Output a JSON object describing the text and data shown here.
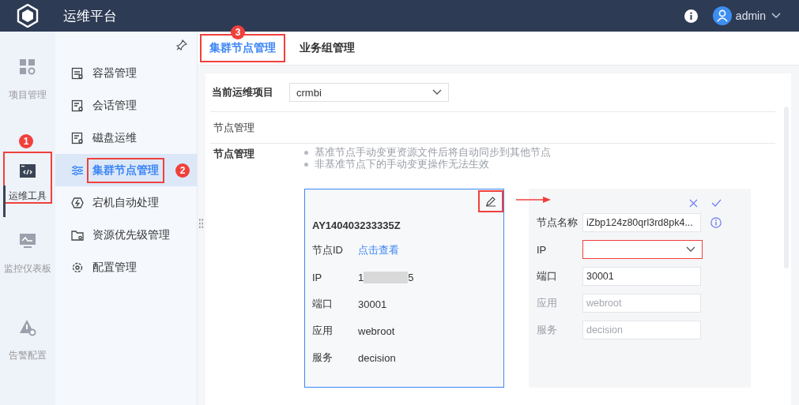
{
  "header": {
    "title": "运维平台",
    "user": "admin"
  },
  "rail": [
    {
      "label": "项目管理",
      "kind": "grid",
      "selected": false
    },
    {
      "label": "运维工具",
      "kind": "code",
      "selected": true,
      "annotation": "1"
    },
    {
      "label": "监控仪表板",
      "kind": "monitor",
      "selected": false
    },
    {
      "label": "告警配置",
      "kind": "alert",
      "selected": false
    }
  ],
  "menu": [
    {
      "label": "容器管理",
      "kind": "container",
      "selected": false
    },
    {
      "label": "会话管理",
      "kind": "session",
      "selected": false
    },
    {
      "label": "磁盘运维",
      "kind": "disk",
      "selected": false
    },
    {
      "label": "集群节点管理",
      "kind": "sliders",
      "selected": true,
      "annotation": "2"
    },
    {
      "label": "宕机自动处理",
      "kind": "bolt",
      "selected": false
    },
    {
      "label": "资源优先级管理",
      "kind": "folder",
      "selected": false
    },
    {
      "label": "配置管理",
      "kind": "gear",
      "selected": false
    }
  ],
  "tabs": [
    {
      "label": "集群节点管理",
      "selected": true,
      "annotation": "3"
    },
    {
      "label": "业务组管理",
      "selected": false
    }
  ],
  "project": {
    "label": "当前运维项目",
    "value": "crmbi"
  },
  "section_title": "节点管理",
  "notes": {
    "label": "节点管理",
    "items": [
      "基准节点手动变更资源文件后将自动同步到其他节点",
      "非基准节点下的手动变更操作无法生效"
    ]
  },
  "node_card": {
    "name": "AY140403233335Z",
    "edit_highlighted": true,
    "rows": [
      {
        "label": "节点ID",
        "kind": "link",
        "value": "点击查看"
      },
      {
        "label": "IP",
        "kind": "redacted",
        "value_start": "1",
        "value_end": "5"
      },
      {
        "label": "端口",
        "kind": "text",
        "value": "30001"
      },
      {
        "label": "应用",
        "kind": "text",
        "value": "webroot"
      },
      {
        "label": "服务",
        "kind": "text",
        "value": "decision"
      }
    ]
  },
  "edit_form": {
    "fields": [
      {
        "label": "节点名称",
        "kind": "text",
        "value": "iZbp124z80qrl3rd8pk4...",
        "disabled": false,
        "info": true,
        "error": false
      },
      {
        "label": "IP",
        "kind": "select",
        "disabled": false,
        "info": false,
        "error": true
      },
      {
        "label": "端口",
        "kind": "text",
        "value": "30001",
        "disabled": false,
        "info": false,
        "error": false
      },
      {
        "label": "应用",
        "kind": "text",
        "value": "webroot",
        "disabled": true,
        "info": false,
        "error": false
      },
      {
        "label": "服务",
        "kind": "text",
        "value": "decision",
        "disabled": true,
        "info": false,
        "error": false
      }
    ]
  }
}
